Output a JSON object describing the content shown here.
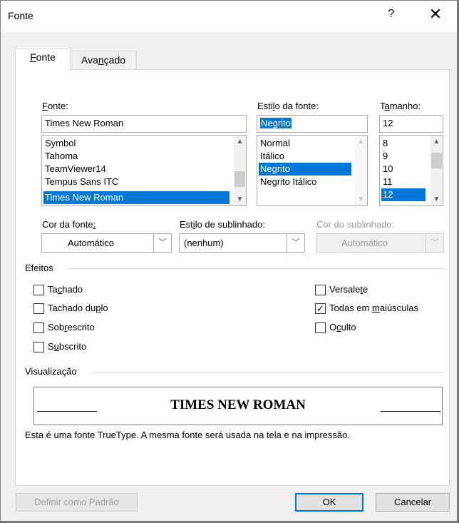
{
  "window": {
    "title": "Fonte",
    "help_symbol": "?",
    "close_symbol": "✕"
  },
  "tabs": [
    {
      "label_pre": "",
      "label_mn": "F",
      "label_post": "onte",
      "active": true
    },
    {
      "label_pre": "Ava",
      "label_mn": "n",
      "label_post": "çado",
      "active": false
    }
  ],
  "font": {
    "label_mn": "F",
    "label_post": "onte:",
    "value": "Times New Roman",
    "items": [
      "Symbol",
      "Tahoma",
      "TeamViewer14",
      "Tempus Sans ITC",
      "Times New Roman"
    ],
    "selected_index": 4
  },
  "style": {
    "label_pre": "Esti",
    "label_mn": "l",
    "label_post": "o da fonte:",
    "value": "Negrito",
    "items": [
      "Normal",
      "Itálico",
      "Negrito",
      "Negrito Itálico"
    ],
    "selected_index": 2
  },
  "size": {
    "label_pre": "T",
    "label_mn": "a",
    "label_post": "manho:",
    "value": "12",
    "items": [
      "8",
      "9",
      "10",
      "11",
      "12"
    ],
    "selected_index": 4
  },
  "font_color": {
    "label_pre": "Cor da fonte",
    "label_mn": ":",
    "value": "Automático"
  },
  "underline_style": {
    "label_pre": "Est",
    "label_mn": "i",
    "label_post": "lo de sublinhado:",
    "value": "(nenhum)"
  },
  "underline_color": {
    "label": "Cor do sublinhado:",
    "value": "Automático"
  },
  "effects": {
    "title": "Efeitos",
    "left": [
      {
        "pre": "Ta",
        "mn": "c",
        "post": "hado",
        "checked": false
      },
      {
        "pre": "Tachado du",
        "mn": "p",
        "post": "lo",
        "checked": false
      },
      {
        "pre": "Sob",
        "mn": "r",
        "post": "escrito",
        "checked": false
      },
      {
        "pre": "S",
        "mn": "u",
        "post": "bscrito",
        "checked": false
      }
    ],
    "right": [
      {
        "pre": "Versale",
        "mn": "t",
        "post": "e",
        "checked": false
      },
      {
        "pre": "Todas em ",
        "mn": "m",
        "post": "aiúsculas",
        "checked": true
      },
      {
        "pre": "O",
        "mn": "c",
        "post": "ulto",
        "checked": false
      }
    ]
  },
  "preview": {
    "title": "Visualização",
    "sample": "TIMES NEW ROMAN",
    "note": "Esta é uma fonte TrueType. A mesma fonte será usada na tela e na impressão."
  },
  "buttons": {
    "set_default": "Definir como Padrão",
    "ok": "OK",
    "cancel": "Cancelar"
  },
  "icons": {
    "up": "▲",
    "down": "▼",
    "check": "✓",
    "chevron": "﹀"
  }
}
